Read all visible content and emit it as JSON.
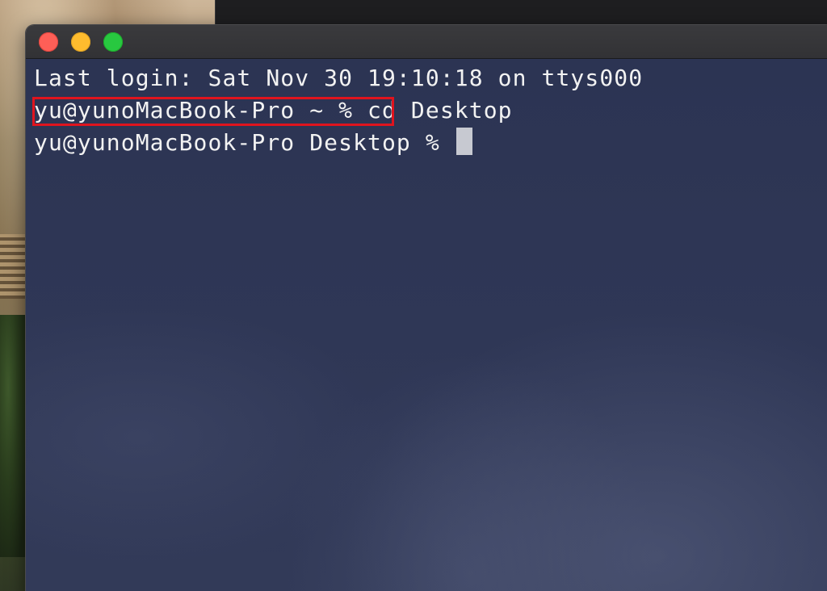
{
  "terminal": {
    "lines": {
      "login": "Last login: Sat Nov 30 19:10:18 on ttys000",
      "prompt1": "yu@yunoMacBook-Pro ~ %",
      "command1": " cd Desktop",
      "prompt2": "yu@yunoMacBook-Pro Desktop % "
    }
  },
  "colors": {
    "background": "#2f3756",
    "text": "#f2f2f2",
    "highlight": "#e0141e",
    "close": "#fe5f57",
    "minimize": "#febc2e",
    "maximize": "#28c840"
  },
  "icons": {
    "close": "close-button-icon",
    "minimize": "minimize-button-icon",
    "maximize": "maximize-button-icon"
  }
}
